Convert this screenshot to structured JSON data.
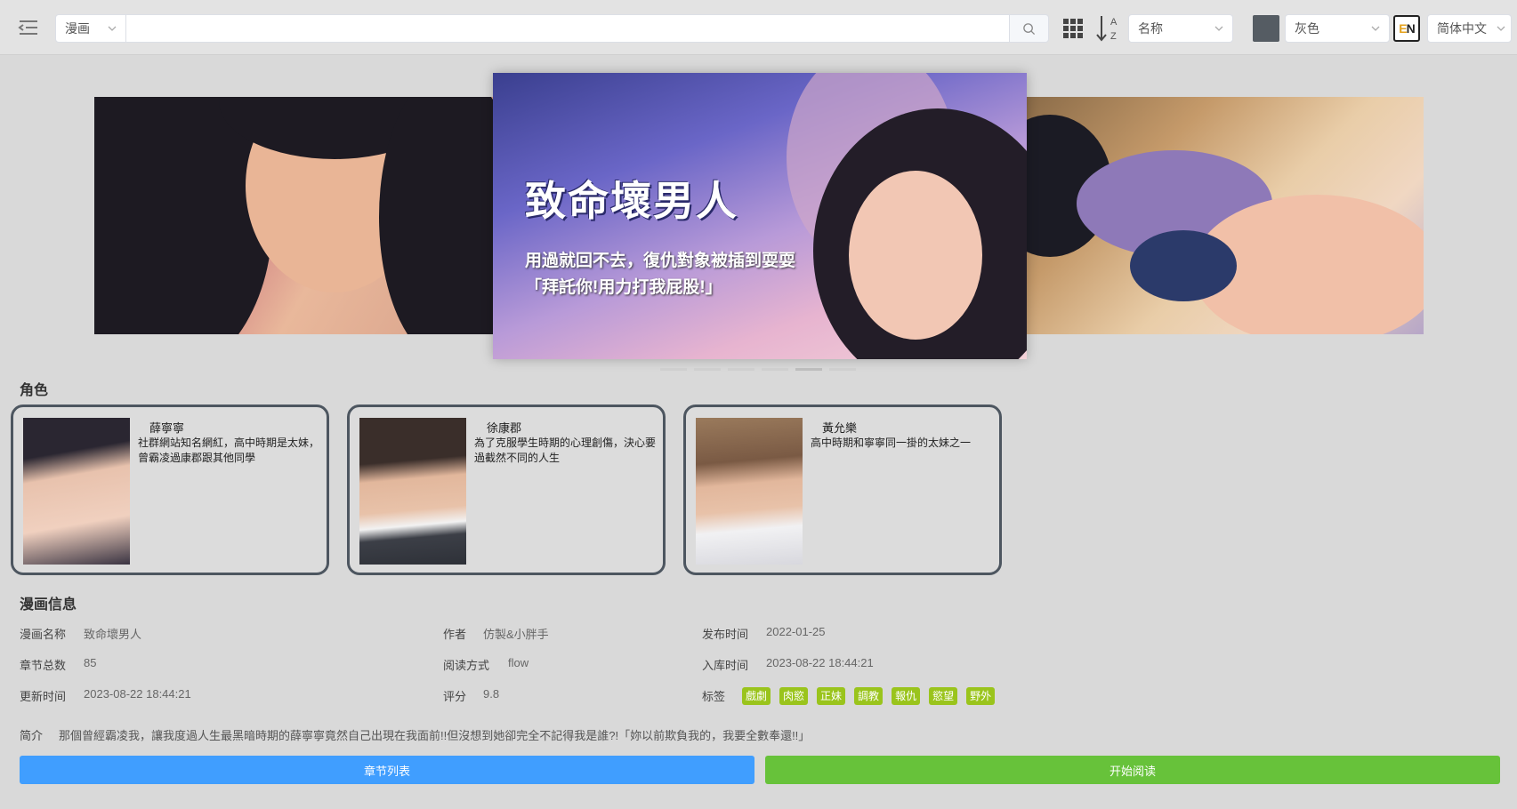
{
  "header": {
    "type_select": "漫画",
    "search": {
      "value": "",
      "placeholder": ""
    },
    "sort_icon_letters": {
      "top": "A",
      "bottom": "Z"
    },
    "sort_select": "名称",
    "theme_color": "#555c63",
    "theme_select": "灰色",
    "lang_badge": {
      "e": "E",
      "n": "N"
    },
    "lang_select": "简体中文"
  },
  "carousel": {
    "center_title": "致命壞男人",
    "center_subtitle_1": "用過就回不去，復仇對象被插到耍耍",
    "center_subtitle_2": "「拜託你!用力打我屁股!」",
    "dot_count": 6,
    "active_dot": 4
  },
  "characters": {
    "title": "角色",
    "items": [
      {
        "name": "薛寧寧",
        "desc": "社群網站知名網紅，高中時期是太妹，曾霸凌過康郡跟其他同學"
      },
      {
        "name": "徐康郡",
        "desc": "為了克服學生時期的心理創傷，決心要過截然不同的人生"
      },
      {
        "name": "黃允樂",
        "desc": "高中時期和寧寧同一掛的太妹之一"
      }
    ]
  },
  "info": {
    "title": "漫画信息",
    "name_label": "漫画名称",
    "name": "致命壞男人",
    "author_label": "作者",
    "author": "仿製&小胖手",
    "publish_label": "发布时间",
    "publish": "2022-01-25",
    "chapters_label": "章节总数",
    "chapters": "85",
    "read_mode_label": "阅读方式",
    "read_mode": "flow",
    "stored_label": "入库时间",
    "stored": "2023-08-22 18:44:21",
    "updated_label": "更新时间",
    "updated": "2023-08-22 18:44:21",
    "rating_label": "评分",
    "rating": "9.8",
    "tags_label": "标签",
    "tags": [
      "戲劇",
      "肉慾",
      "正妹",
      "調教",
      "報仇",
      "慾望",
      "野外"
    ],
    "tag_color": "#9ac41c",
    "intro_label": "简介",
    "intro": "那個曾經霸凌我，讓我度過人生最黑暗時期的薛寧寧竟然自己出現在我面前!!但沒想到她卻完全不記得我是誰?!「妳以前欺負我的，我要全數奉還!!」"
  },
  "actions": {
    "chapter_list": "章节列表",
    "start_reading": "开始阅读",
    "blue": "#409eff",
    "green": "#67c23a"
  }
}
